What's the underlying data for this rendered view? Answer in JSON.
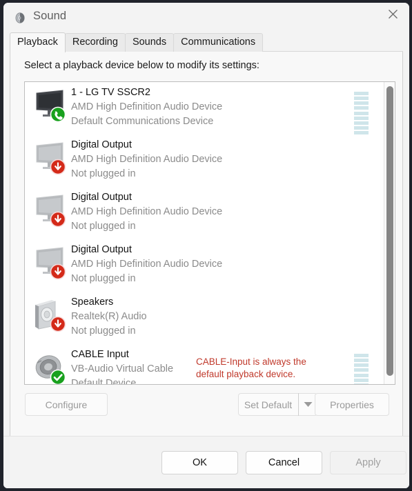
{
  "window": {
    "title": "Sound",
    "icon": "speaker-icon",
    "close_label": "✕"
  },
  "tabs": [
    {
      "label": "Playback",
      "active": true
    },
    {
      "label": "Recording",
      "active": false
    },
    {
      "label": "Sounds",
      "active": false
    },
    {
      "label": "Communications",
      "active": false
    }
  ],
  "instruction": "Select a playback device below to modify its settings:",
  "annotation": {
    "text": "CABLE-Input is always the\ndefault playback device.",
    "color": "#c0392b"
  },
  "devices": [
    {
      "name": "1 - LG TV SSCR2",
      "driver": "AMD High Definition Audio Device",
      "status": "Default Communications Device",
      "icon": "tv-icon",
      "icon_state": "active",
      "badge": "green-phone-badge",
      "meter": true,
      "meter_segments": 9
    },
    {
      "name": "Digital Output",
      "driver": "AMD High Definition Audio Device",
      "status": "Not plugged in",
      "icon": "tv-icon",
      "icon_state": "disabled",
      "badge": "red-arrow-badge",
      "meter": false,
      "meter_segments": 0
    },
    {
      "name": "Digital Output",
      "driver": "AMD High Definition Audio Device",
      "status": "Not plugged in",
      "icon": "tv-icon",
      "icon_state": "disabled",
      "badge": "red-arrow-badge",
      "meter": false,
      "meter_segments": 0
    },
    {
      "name": "Digital Output",
      "driver": "AMD High Definition Audio Device",
      "status": "Not plugged in",
      "icon": "tv-icon",
      "icon_state": "disabled",
      "badge": "red-arrow-badge",
      "meter": false,
      "meter_segments": 0
    },
    {
      "name": "Speakers",
      "driver": "Realtek(R) Audio",
      "status": "Not plugged in",
      "icon": "speaker-box-icon",
      "icon_state": "disabled",
      "badge": "red-arrow-badge",
      "meter": false,
      "meter_segments": 0
    },
    {
      "name": "CABLE Input",
      "driver": "VB-Audio Virtual Cable",
      "status": "Default Device",
      "icon": "speaker-driver-icon",
      "icon_state": "active",
      "badge": "green-check-badge",
      "meter": true,
      "meter_segments": 9
    }
  ],
  "actions": {
    "configure": "Configure",
    "set_default": "Set Default",
    "set_default_arrow": "▼",
    "properties": "Properties"
  },
  "footer": {
    "ok": "OK",
    "cancel": "Cancel",
    "apply": "Apply"
  },
  "colors": {
    "accent_red": "#c0392b",
    "badge_green": "#19a11e",
    "badge_red": "#d42a19",
    "meter_fill": "#cfe5ea"
  }
}
